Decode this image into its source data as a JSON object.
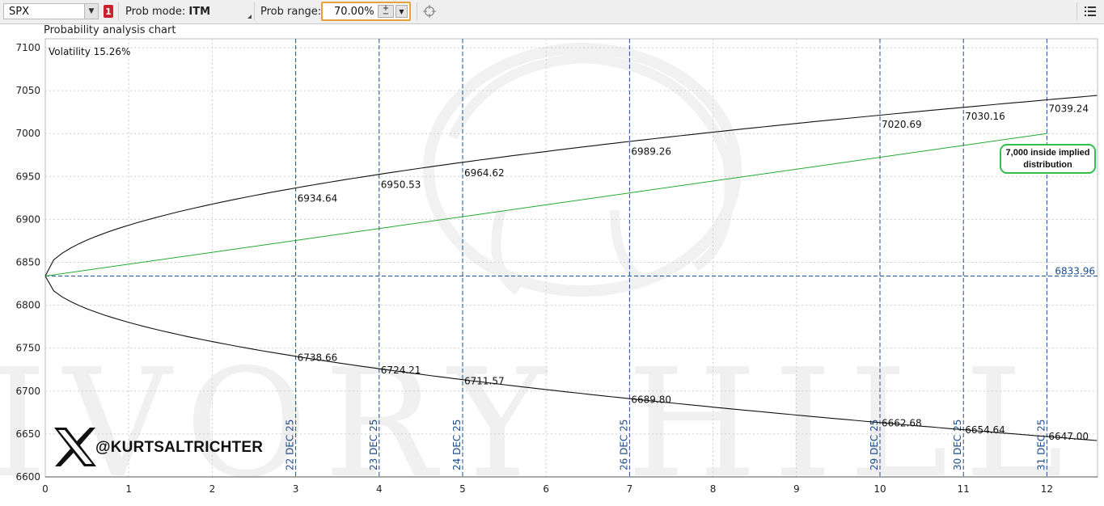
{
  "toolbar": {
    "symbol": "SPX",
    "badge": "1",
    "prob_mode_label": "Prob mode:",
    "prob_mode_value": "ITM",
    "prob_range_label": "Prob range:",
    "prob_range_value": "70.00%",
    "icons": [
      "chevron-down-icon",
      "crosshair-icon",
      "menu-icon"
    ]
  },
  "chart_title": "Probability analysis chart",
  "volatility_label": "Volatility 15.26%",
  "callout": {
    "line1": "7,000 inside implied",
    "line2": "distribution"
  },
  "handle": "@KURTSALTRICHTER",
  "watermark": {
    "text": "IVORY HILL"
  },
  "colors": {
    "axis_grid": "#c8c8c8",
    "date_line": "#1f4e8c",
    "green": "#22aa33",
    "callout_border": "#2fbf4a",
    "accent": "#e3a33a",
    "badge": "#c8202f"
  },
  "chart_data": {
    "type": "line",
    "title": "Probability analysis chart",
    "xlabel": "",
    "ylabel": "",
    "xlim": [
      0,
      12.6
    ],
    "ylim": [
      6600,
      7100
    ],
    "x_ticks": [
      "0",
      "1",
      "2",
      "3",
      "4",
      "5",
      "6",
      "7",
      "8",
      "9",
      "10",
      "11",
      "12"
    ],
    "y_ticks": [
      "6600",
      "6650",
      "6700",
      "6750",
      "6800",
      "6850",
      "6900",
      "6950",
      "7000",
      "7050",
      "7100"
    ],
    "grid": true,
    "current_price": 6833.96,
    "current_price_label": "6833.96",
    "date_markers": [
      {
        "x": 3,
        "label": "22 DEC 25"
      },
      {
        "x": 4,
        "label": "23 DEC 25"
      },
      {
        "x": 5,
        "label": "24 DEC 25"
      },
      {
        "x": 7,
        "label": "26 DEC 25"
      },
      {
        "x": 10,
        "label": "29 DEC 25"
      },
      {
        "x": 11,
        "label": "30 DEC 25"
      },
      {
        "x": 12,
        "label": "31 DEC 25"
      }
    ],
    "series": [
      {
        "role": "upper",
        "x": [
          3,
          4,
          5,
          7,
          10,
          11,
          12
        ],
        "values": [
          6934.64,
          6950.53,
          6964.62,
          6989.26,
          7020.69,
          7030.16,
          7039.24
        ],
        "labels": [
          "6934.64",
          "6950.53",
          "6964.62",
          "6989.26",
          "7020.69",
          "7030.16",
          "7039.24"
        ]
      },
      {
        "role": "lower",
        "x": [
          3,
          4,
          5,
          7,
          10,
          11,
          12
        ],
        "values": [
          6738.66,
          6724.21,
          6711.57,
          6689.8,
          6662.68,
          6654.64,
          6647.0
        ],
        "labels": [
          "6738.66",
          "6724.21",
          "6711.57",
          "6689.80",
          "6662.68",
          "6654.64",
          "6647.00"
        ]
      },
      {
        "role": "target-line",
        "x": [
          0,
          12
        ],
        "values": [
          6833.96,
          7000
        ]
      }
    ]
  }
}
